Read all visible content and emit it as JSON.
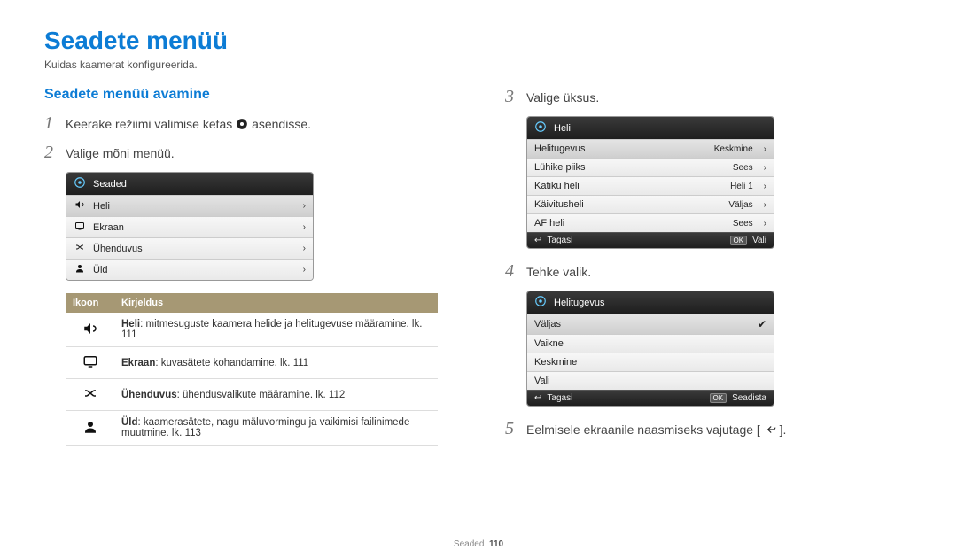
{
  "page": {
    "title": "Seadete menüü",
    "subtitle": "Kuidas kaamerat konfigureerida.",
    "section_heading": "Seadete menüü avamine",
    "footer_label": "Seaded",
    "footer_page": "110"
  },
  "steps": {
    "s1_pre": "Keerake režiimi valimise ketas ",
    "s1_post": " asendisse.",
    "s2": "Valige mõni menüü.",
    "s3": "Valige üksus.",
    "s4": "Tehke valik.",
    "s5_pre": "Eelmisele ekraanile naasmiseks vajutage [",
    "s5_post": "]."
  },
  "panel1": {
    "title": "Seaded",
    "rows": [
      {
        "label": "Heli"
      },
      {
        "label": "Ekraan"
      },
      {
        "label": "Ühenduvus"
      },
      {
        "label": "Üld"
      }
    ]
  },
  "desc_table": {
    "col_icon": "Ikoon",
    "col_desc": "Kirjeldus",
    "rows": [
      {
        "bold": "Heli",
        "rest": ": mitmesuguste kaamera helide ja helitugevuse määramine. lk. 111"
      },
      {
        "bold": "Ekraan",
        "rest": ": kuvasätete kohandamine. lk. 111"
      },
      {
        "bold": "Ühenduvus",
        "rest": ": ühendusvalikute määramine. lk. 112"
      },
      {
        "bold": "Üld",
        "rest": ": kaamerasätete, nagu mäluvormingu ja vaikimisi failinimede muutmine. lk. 113"
      }
    ]
  },
  "panel2": {
    "title": "Heli",
    "rows": [
      {
        "label": "Helitugevus",
        "value": "Keskmine",
        "hl": true
      },
      {
        "label": "Lühike piiks",
        "value": "Sees"
      },
      {
        "label": "Katiku heli",
        "value": "Heli 1"
      },
      {
        "label": "Käivitusheli",
        "value": "Väljas"
      },
      {
        "label": "AF heli",
        "value": "Sees"
      }
    ],
    "back": "Tagasi",
    "ok": "Vali"
  },
  "panel3": {
    "title": "Helitugevus",
    "rows": [
      {
        "label": "Väljas",
        "checked": true
      },
      {
        "label": "Vaikne"
      },
      {
        "label": "Keskmine"
      },
      {
        "label": "Vali"
      }
    ],
    "back": "Tagasi",
    "ok": "Seadista"
  }
}
